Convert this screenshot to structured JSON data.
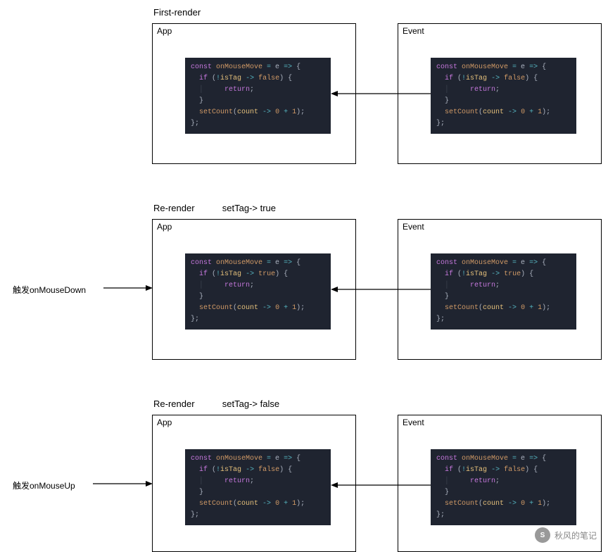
{
  "rows": [
    {
      "heading_main": "First-render",
      "heading_sub": "",
      "side_label": "",
      "app_title": "App",
      "event_title": "Event",
      "app_code_tag": "false",
      "event_code_tag": "false"
    },
    {
      "heading_main": "Re-render",
      "heading_sub": "setTag-> true",
      "side_label": "触发onMouseDown",
      "app_title": "App",
      "event_title": "Event",
      "app_code_tag": "true",
      "event_code_tag": "true"
    },
    {
      "heading_main": "Re-render",
      "heading_sub": "setTag-> false",
      "side_label": "触发onMouseUp",
      "app_title": "App",
      "event_title": "Event",
      "app_code_tag": "false",
      "event_code_tag": "false"
    }
  ],
  "code_template": {
    "l1_a": "const",
    "l1_b": " onMouseMove ",
    "l1_c": "=",
    "l1_d": " e ",
    "l1_e": "=>",
    "l1_f": " {",
    "l2_a": "  if",
    "l2_b": " (",
    "l2_c": "!",
    "l2_d": "isTag",
    "l2_e": " -> ",
    "l2_f_end": ") {",
    "l3": "    return",
    "l3_semi": ";",
    "l4": "  }",
    "l5_a": "  setCount",
    "l5_b": "(",
    "l5_c": "count",
    "l5_d": " -> ",
    "l5_e": "0",
    "l5_f": " + ",
    "l5_g": "1",
    "l5_h": ");",
    "l6": "};"
  },
  "watermark": {
    "icon": "S",
    "text": "秋风的笔记"
  }
}
